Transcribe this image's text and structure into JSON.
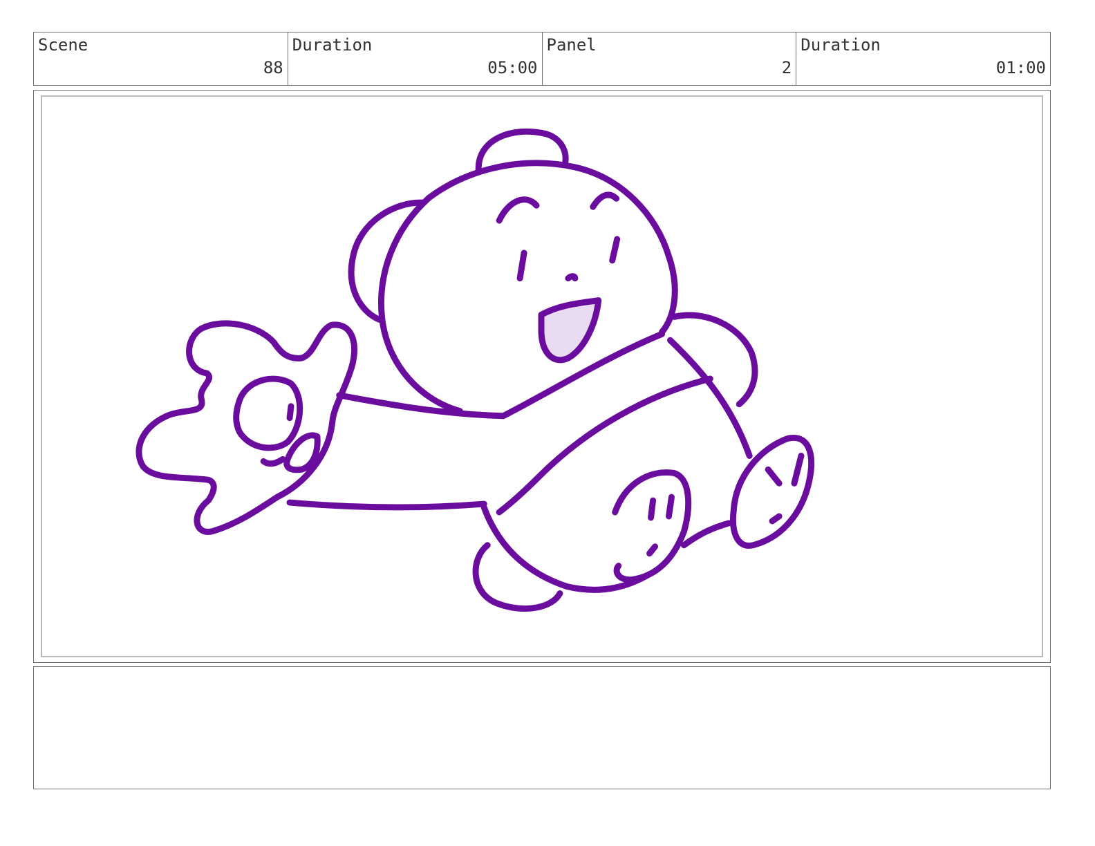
{
  "header": {
    "scene": {
      "label": "Scene",
      "value": "88"
    },
    "scene_duration": {
      "label": "Duration",
      "value": "05:00"
    },
    "panel": {
      "label": "Panel",
      "value": "2"
    },
    "panel_duration": {
      "label": "Duration",
      "value": "01:00"
    }
  },
  "drawing": {
    "subject": "bear-drawing",
    "line_color": "#6a0d9e"
  },
  "notes": {
    "text": ""
  }
}
